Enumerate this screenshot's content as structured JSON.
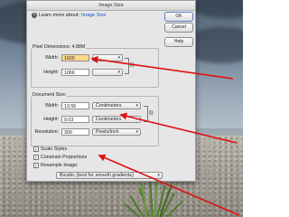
{
  "dialog": {
    "title": "Image Size",
    "learn_prefix": "Learn more about:",
    "learn_link": "Image Size",
    "buttons": {
      "ok": "OK",
      "cancel": "Cancel",
      "help": "Help"
    }
  },
  "pixel_dimensions": {
    "legend": "Pixel Dimensions: 4.88M",
    "width_label": "Width:",
    "width_value": "1600",
    "height_label": "Height:",
    "height_value": "1066"
  },
  "document_size": {
    "legend": "Document Size:",
    "width_label": "Width:",
    "width_value": "13.55",
    "width_unit": "Centimeters",
    "height_label": "Height:",
    "height_value": "9.03",
    "height_unit": "Centimeters",
    "resolution_label": "Resolution:",
    "resolution_value": "300",
    "resolution_unit": "Pixels/Inch"
  },
  "options": {
    "scale_styles": "Scale Styles",
    "constrain": "Constrain Proportions",
    "resample": "Resample Image:",
    "resample_method": "Bicubic (best for smooth gradients)"
  },
  "colors": {
    "annotation_arrow": "#e01010",
    "field_highlight": "#ffd98a"
  }
}
